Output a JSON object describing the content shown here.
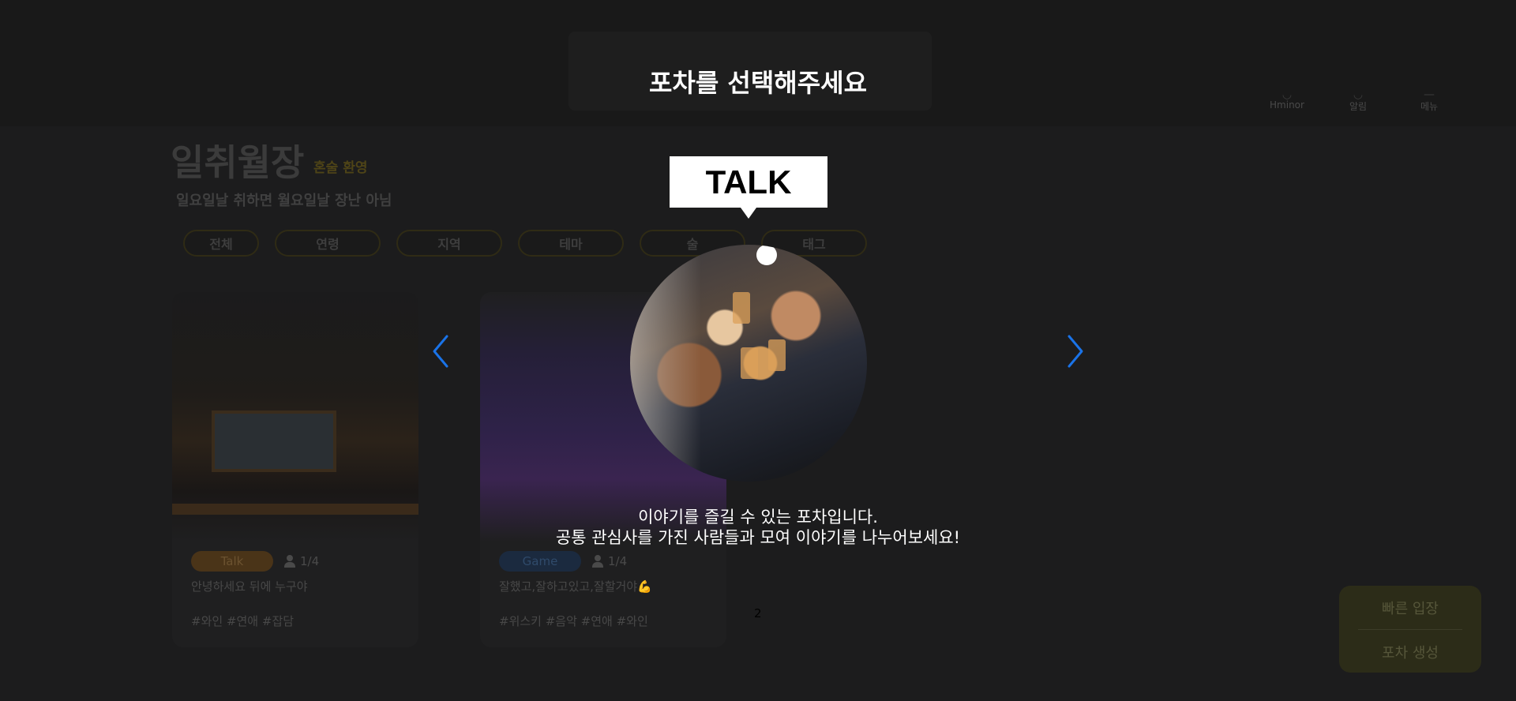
{
  "header": {
    "nav": [
      {
        "icon": "user-icon",
        "label": "Hminor"
      },
      {
        "icon": "bell-icon",
        "label": "알림"
      },
      {
        "icon": "menu-icon",
        "label": "메뉴"
      }
    ]
  },
  "hero": {
    "title": "일취월장",
    "badge": "혼술 환영",
    "subtitle": "일요일날 취하면 월요일날 장난 아님"
  },
  "filters": [
    "전체",
    "연령",
    "지역",
    "테마",
    "술",
    "태그"
  ],
  "cards": [
    {
      "type": "Talk",
      "count": "1/4",
      "description": "안녕하세요 뒤에 누구야",
      "hashtags": "#와인 #연애 #잡담"
    },
    {
      "type": "Game",
      "count": "1/4",
      "description": "잘했고,잘하고있고,잘할거야💪",
      "hashtags": "#위스키 #음악 #연애 #와인"
    }
  ],
  "page_number": "2",
  "quick_panel": {
    "enter_label": "빠른 입장",
    "create_label": "포차 생성"
  },
  "modal": {
    "title": "포차를 선택해주세요",
    "badge_text": "TALK",
    "description_line1": "이야기를 즐길 수 있는 포차입니다.",
    "description_line2": "공통 관심사를 가진 사람들과 모여 이야기를 나누어보세요!",
    "prev_icon": "chevron-left-icon",
    "next_icon": "chevron-right-icon",
    "arrow_color": "#1a73e8"
  }
}
